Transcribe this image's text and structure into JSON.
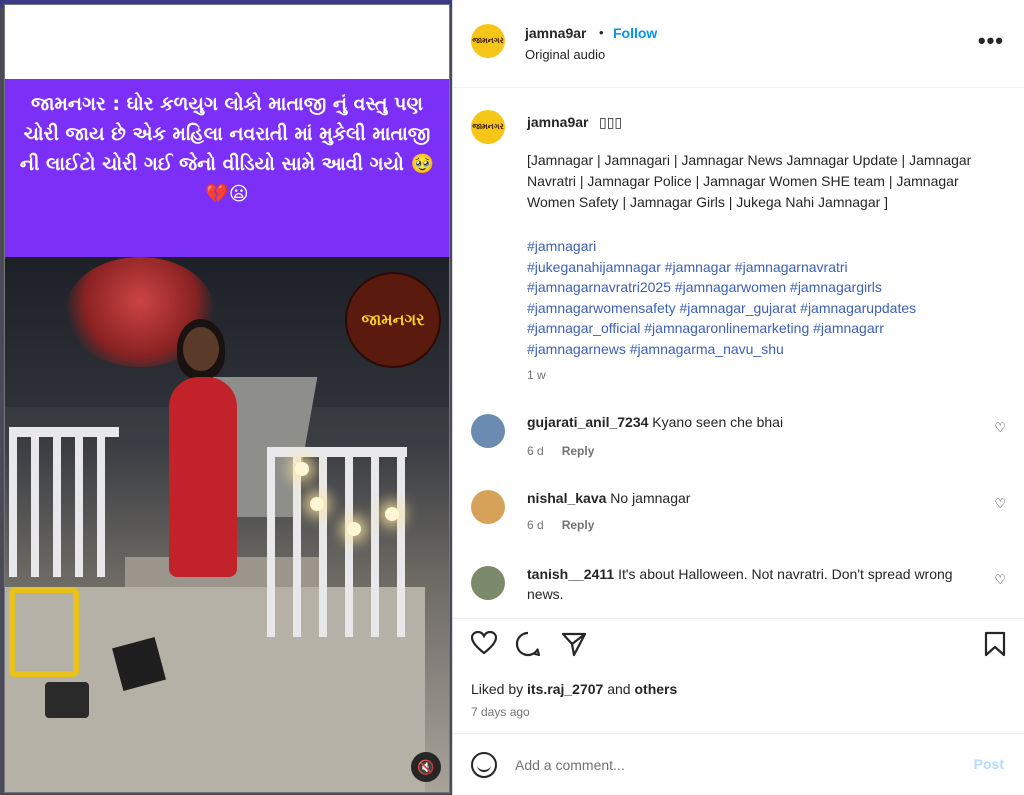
{
  "media": {
    "banner_text": "જામનગર : ઘોર કળયુગ લોકો માતાજી નું વસ્તુ પણ ચોરી જાય છે એક મહિલા નવરાતી માં મુકેલી માતાજી ની લાઈટો ચોરી ગઈ જેનો વીડિયો સામે આવી ગયો 🥹💔😦",
    "logo_text": "જામનગર",
    "mute_icon": "speaker-muted-icon"
  },
  "header": {
    "username": "jamna9ar",
    "dot": "•",
    "follow_label": "Follow",
    "audio_label": "Original audio",
    "more_icon": "•••"
  },
  "post": {
    "username": "jamna9ar",
    "username_suffix": "▯▯▯",
    "caption": "[Jamnagar | Jamnagari | Jamnagar News Jamnagar Update | Jamnagar Navratri | Jamnagar Police | Jamnagar Women SHE team | Jamnagar Women Safety | Jamnagar Girls | Jukega Nahi Jamnagar ]",
    "hashtags": [
      "#jamnagari",
      "#jukeganahijamnagar #jamnagar #jamnagarnavratri",
      "#jamnagarnavratri2025 #jamnagarwomen #jamnagargirls",
      "#jamnagarwomensafety #jamnagar_gujarat #jamnagarupdates",
      "#jamnagar_official #jamnagaronlinemarketing #jamnagarr",
      "#jamnagarnews #jamnagarma_navu_shu"
    ],
    "age": "1 w"
  },
  "comments": [
    {
      "user": "gujarati_anil_7234",
      "text": "Kyano seen che bhai",
      "age": "6 d",
      "reply": "Reply",
      "avatar_color": "#6b8bb0"
    },
    {
      "user": "nishal_kava",
      "text": "No jamnagar",
      "age": "6 d",
      "reply": "Reply",
      "avatar_color": "#d6a25a"
    },
    {
      "user": "tanish__2411",
      "text": "It's about Halloween. Not navratri. Don't spread wrong news.",
      "age": "",
      "reply": "",
      "avatar_color": "#7a8a6a"
    }
  ],
  "actions": {
    "liked_prefix": "Liked by",
    "liked_user": "its.raj_2707",
    "liked_and": "and",
    "liked_others": "others",
    "date": "7 days ago"
  },
  "composer": {
    "placeholder": "Add a comment...",
    "post_label": "Post"
  }
}
